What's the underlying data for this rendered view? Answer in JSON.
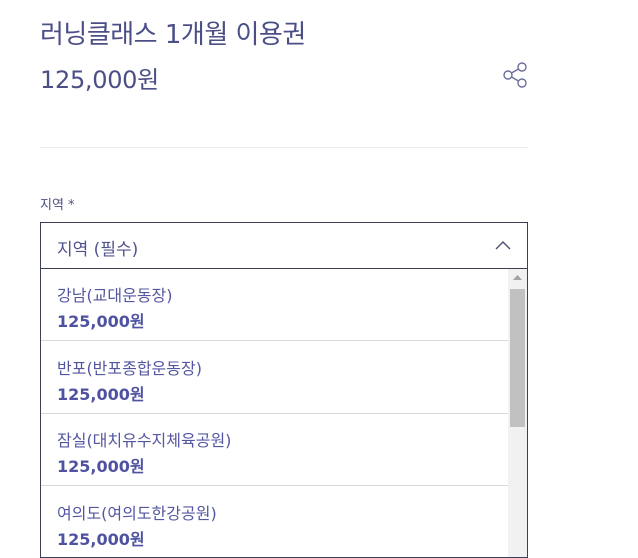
{
  "product": {
    "title": "러닝클래스 1개월 이용권",
    "price": "125,000원"
  },
  "share": {
    "icon": "share-icon"
  },
  "region_field": {
    "label": "지역 *",
    "selected_value": "지역 (필수)",
    "chevron_icon": "chevron-up-icon"
  },
  "options": [
    {
      "name": "강남(교대운동장)",
      "price": "125,000원"
    },
    {
      "name": "반포(반포종합운동장)",
      "price": "125,000원"
    },
    {
      "name": "잠실(대치유수지체육공원)",
      "price": "125,000원"
    },
    {
      "name": "여의도(여의도한강공원)",
      "price": "125,000원"
    }
  ],
  "colors": {
    "accent": "#4b4f86",
    "option_text": "#5357a0",
    "border": "#3c3f58",
    "divider": "#d7d8de"
  }
}
